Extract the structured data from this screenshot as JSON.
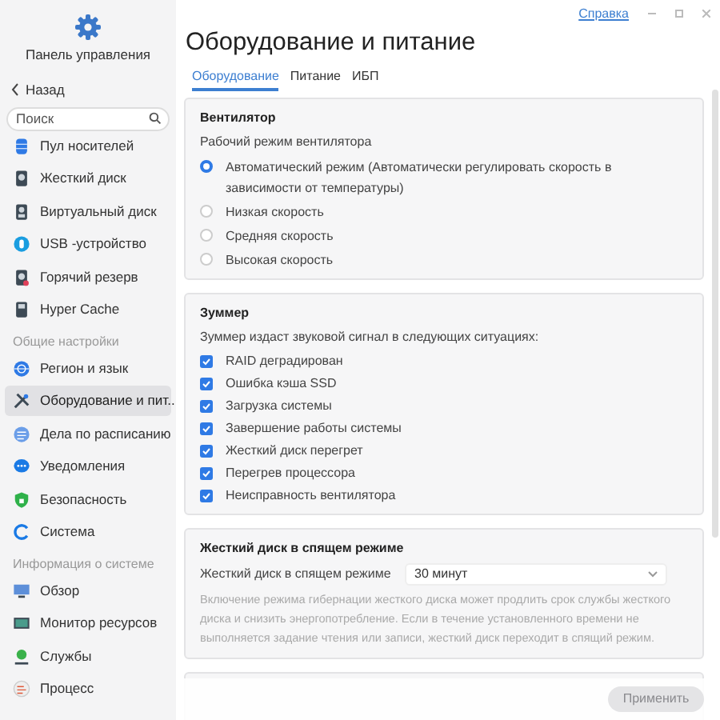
{
  "sidebar": {
    "title": "Панель управления",
    "back": "Назад",
    "search": {
      "placeholder": "Поиск"
    },
    "groups": [
      {
        "items": [
          {
            "label": "Пул носителей",
            "selected": false
          },
          {
            "label": "Жесткий диск",
            "selected": false
          },
          {
            "label": "Виртуальный диск",
            "selected": false
          },
          {
            "label": "USB -устройство",
            "selected": false
          },
          {
            "label": "Горячий резерв",
            "selected": false
          },
          {
            "label": "Hyper Cache",
            "selected": false
          }
        ]
      },
      {
        "heading": "Общие настройки",
        "items": [
          {
            "label": "Регион и язык",
            "selected": false
          },
          {
            "label": "Оборудование и пит...",
            "selected": true
          },
          {
            "label": "Дела по расписанию",
            "selected": false
          },
          {
            "label": "Уведомления",
            "selected": false
          },
          {
            "label": "Безопасность",
            "selected": false
          },
          {
            "label": "Система",
            "selected": false
          }
        ]
      },
      {
        "heading": "Информация о системе",
        "items": [
          {
            "label": "Обзор",
            "selected": false
          },
          {
            "label": "Монитор ресурсов",
            "selected": false
          },
          {
            "label": "Службы",
            "selected": false
          },
          {
            "label": "Процесс",
            "selected": false
          }
        ]
      }
    ]
  },
  "help_link": "Справка",
  "page_title": "Оборудование и питание",
  "tabs": [
    {
      "label": "Оборудование",
      "selected": true
    },
    {
      "label": "Питание",
      "selected": false
    },
    {
      "label": "ИБП",
      "selected": false
    }
  ],
  "fan": {
    "title": "Вентилятор",
    "subtitle": "Рабочий режим вентилятора",
    "options": [
      {
        "label": "Автоматический режим (Автоматически регулировать скорость в зависимости от температуры)",
        "selected": true
      },
      {
        "label": "Низкая скорость",
        "selected": false
      },
      {
        "label": "Средняя скорость",
        "selected": false
      },
      {
        "label": "Высокая скорость",
        "selected": false
      }
    ]
  },
  "buzzer": {
    "title": "Зуммер",
    "subtitle": "Зуммер издаст звуковой сигнал в следующих ситуациях:",
    "items": [
      {
        "label": "RAID деградирован",
        "checked": true
      },
      {
        "label": "Ошибка кэша SSD",
        "checked": true
      },
      {
        "label": "Загрузка системы",
        "checked": true
      },
      {
        "label": "Завершение работы системы",
        "checked": true
      },
      {
        "label": "Жесткий диск перегрет",
        "checked": true
      },
      {
        "label": "Перегрев процессора",
        "checked": true
      },
      {
        "label": "Неисправность вентилятора",
        "checked": true
      }
    ]
  },
  "hibernation": {
    "title": "Жесткий диск в спящем режиме",
    "field_label": "Жесткий диск в спящем режиме",
    "value": "30 минут",
    "description": "Включение режима гибернации жесткого диска может продлить срок службы жесткого диска и снизить энергопотребление. Если в течение установленного времени не выполняется задание чтения или записи, жесткий диск переходит в спящий режим."
  },
  "apply_button": {
    "label": "Применить",
    "disabled": true
  }
}
